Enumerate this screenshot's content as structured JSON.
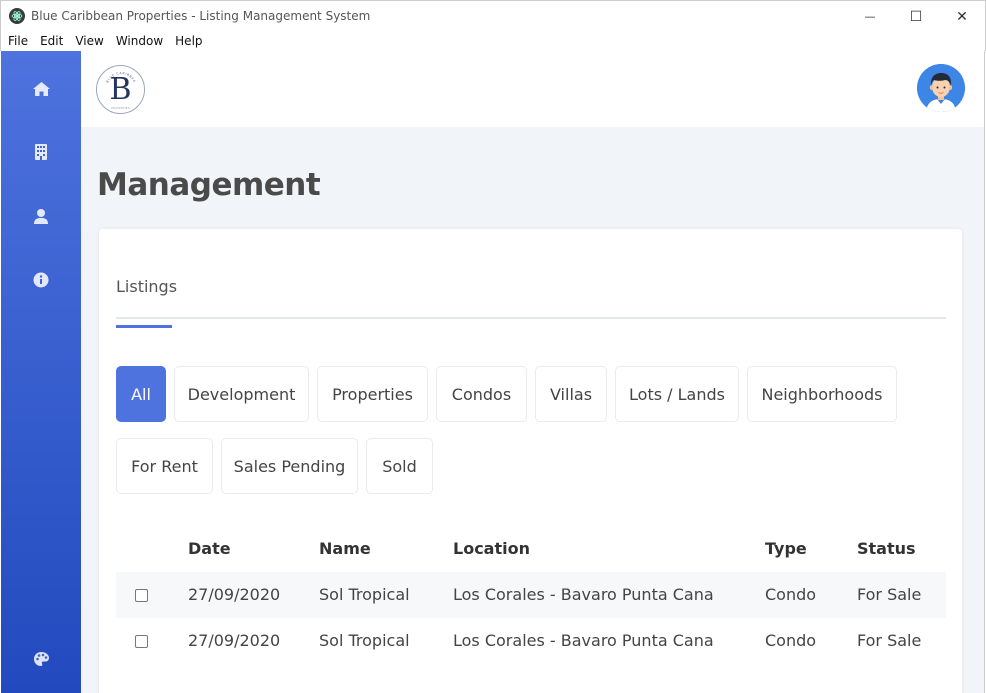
{
  "window": {
    "title": "Blue Caribbean Properties - Listing Management System",
    "controls": {
      "minimize": "—",
      "maximize": "☐",
      "close": "✕"
    }
  },
  "menu": [
    "File",
    "Edit",
    "View",
    "Window",
    "Help"
  ],
  "sidebar": {
    "items": [
      {
        "icon": "home-icon"
      },
      {
        "icon": "building-icon"
      },
      {
        "icon": "user-icon"
      },
      {
        "icon": "info-icon"
      },
      {
        "icon": "palette-icon"
      }
    ]
  },
  "header": {
    "logo_letter": "B",
    "logo_ring_text": "BLUE CARIBBEAN",
    "logo_sub_text": "PROPERTIES"
  },
  "page_title": "Management",
  "tabs": [
    {
      "label": "Listings",
      "active": true
    }
  ],
  "filters": [
    {
      "label": "All",
      "active": true
    },
    {
      "label": "Development"
    },
    {
      "label": "Properties"
    },
    {
      "label": "Condos"
    },
    {
      "label": "Villas"
    },
    {
      "label": "Lots / Lands"
    },
    {
      "label": "Neighborhoods"
    },
    {
      "label": "For Rent"
    },
    {
      "label": "Sales Pending"
    },
    {
      "label": "Sold"
    }
  ],
  "table": {
    "columns": [
      "Date",
      "Name",
      "Location",
      "Type",
      "Status"
    ],
    "rows": [
      {
        "date": "27/09/2020",
        "name": "Sol Tropical",
        "location": "Los Corales - Bavaro Punta Cana",
        "type": "Condo",
        "status": "For Sale"
      },
      {
        "date": "27/09/2020",
        "name": "Sol Tropical",
        "location": "Los Corales - Bavaro Punta Cana",
        "type": "Condo",
        "status": "For Sale"
      }
    ]
  },
  "colors": {
    "accent": "#4e73df",
    "sidebar_top": "#4e73df",
    "sidebar_bottom": "#224abe"
  }
}
